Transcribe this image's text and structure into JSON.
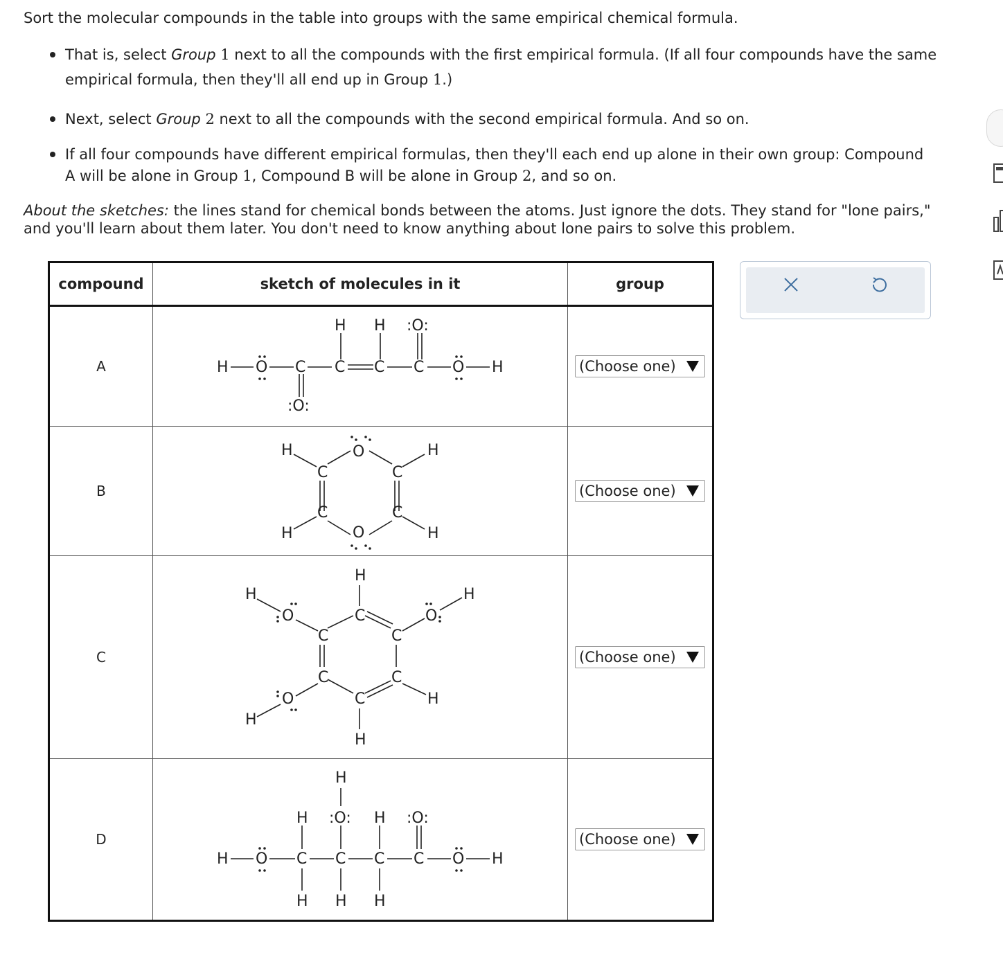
{
  "instructions": {
    "intro": "Sort the molecular compounds in the table into groups with the same empirical chemical formula.",
    "bullet1_pre": "That is, select ",
    "bullet1_group": "Group",
    "bullet1_num": "1",
    "bullet1_post": " next to all the compounds with the first empirical formula. (If all four compounds have the same",
    "bullet1_line2_pre": "empirical formula, then they'll all end up in Group ",
    "bullet1_line2_num": "1",
    "bullet1_line2_post": ".)",
    "bullet2_pre": "Next, select ",
    "bullet2_group": "Group",
    "bullet2_num": "2",
    "bullet2_post": " next to all the compounds with the second empirical formula. And so on.",
    "bullet3_line1": "If all four compounds have different empirical formulas, then they'll each end up alone in their own group: Compound",
    "bullet3_a": "A will be alone in Group ",
    "bullet3_num1": "1",
    "bullet3_b": ", Compound B will be alone in Group ",
    "bullet3_num2": "2",
    "bullet3_c": ", and so on.",
    "sketch_label": "About the sketches:",
    "sketch_text": " the lines stand for chemical bonds between the atoms. Just ignore the dots. They stand for \"lone pairs,\" and you'll learn about them later. You don't need to know anything about lone pairs to solve this problem."
  },
  "table": {
    "headers": {
      "compound": "compound",
      "sketch": "sketch of molecules in it",
      "group": "group"
    },
    "rows": [
      {
        "compound": "A",
        "group_select": "(Choose one)"
      },
      {
        "compound": "B",
        "group_select": "(Choose one)"
      },
      {
        "compound": "C",
        "group_select": "(Choose one)"
      },
      {
        "compound": "D",
        "group_select": "(Choose one)"
      }
    ]
  },
  "atoms": {
    "H": "H",
    "C": "C",
    "O": "O",
    "O_pair": ":O:"
  },
  "toolbar": {
    "clear_icon": "close-icon",
    "reset_icon": "undo-icon"
  },
  "colors": {
    "accent": "#3f6fa0",
    "panel_bg": "#e9edf2",
    "panel_border": "#b9c6d6"
  }
}
